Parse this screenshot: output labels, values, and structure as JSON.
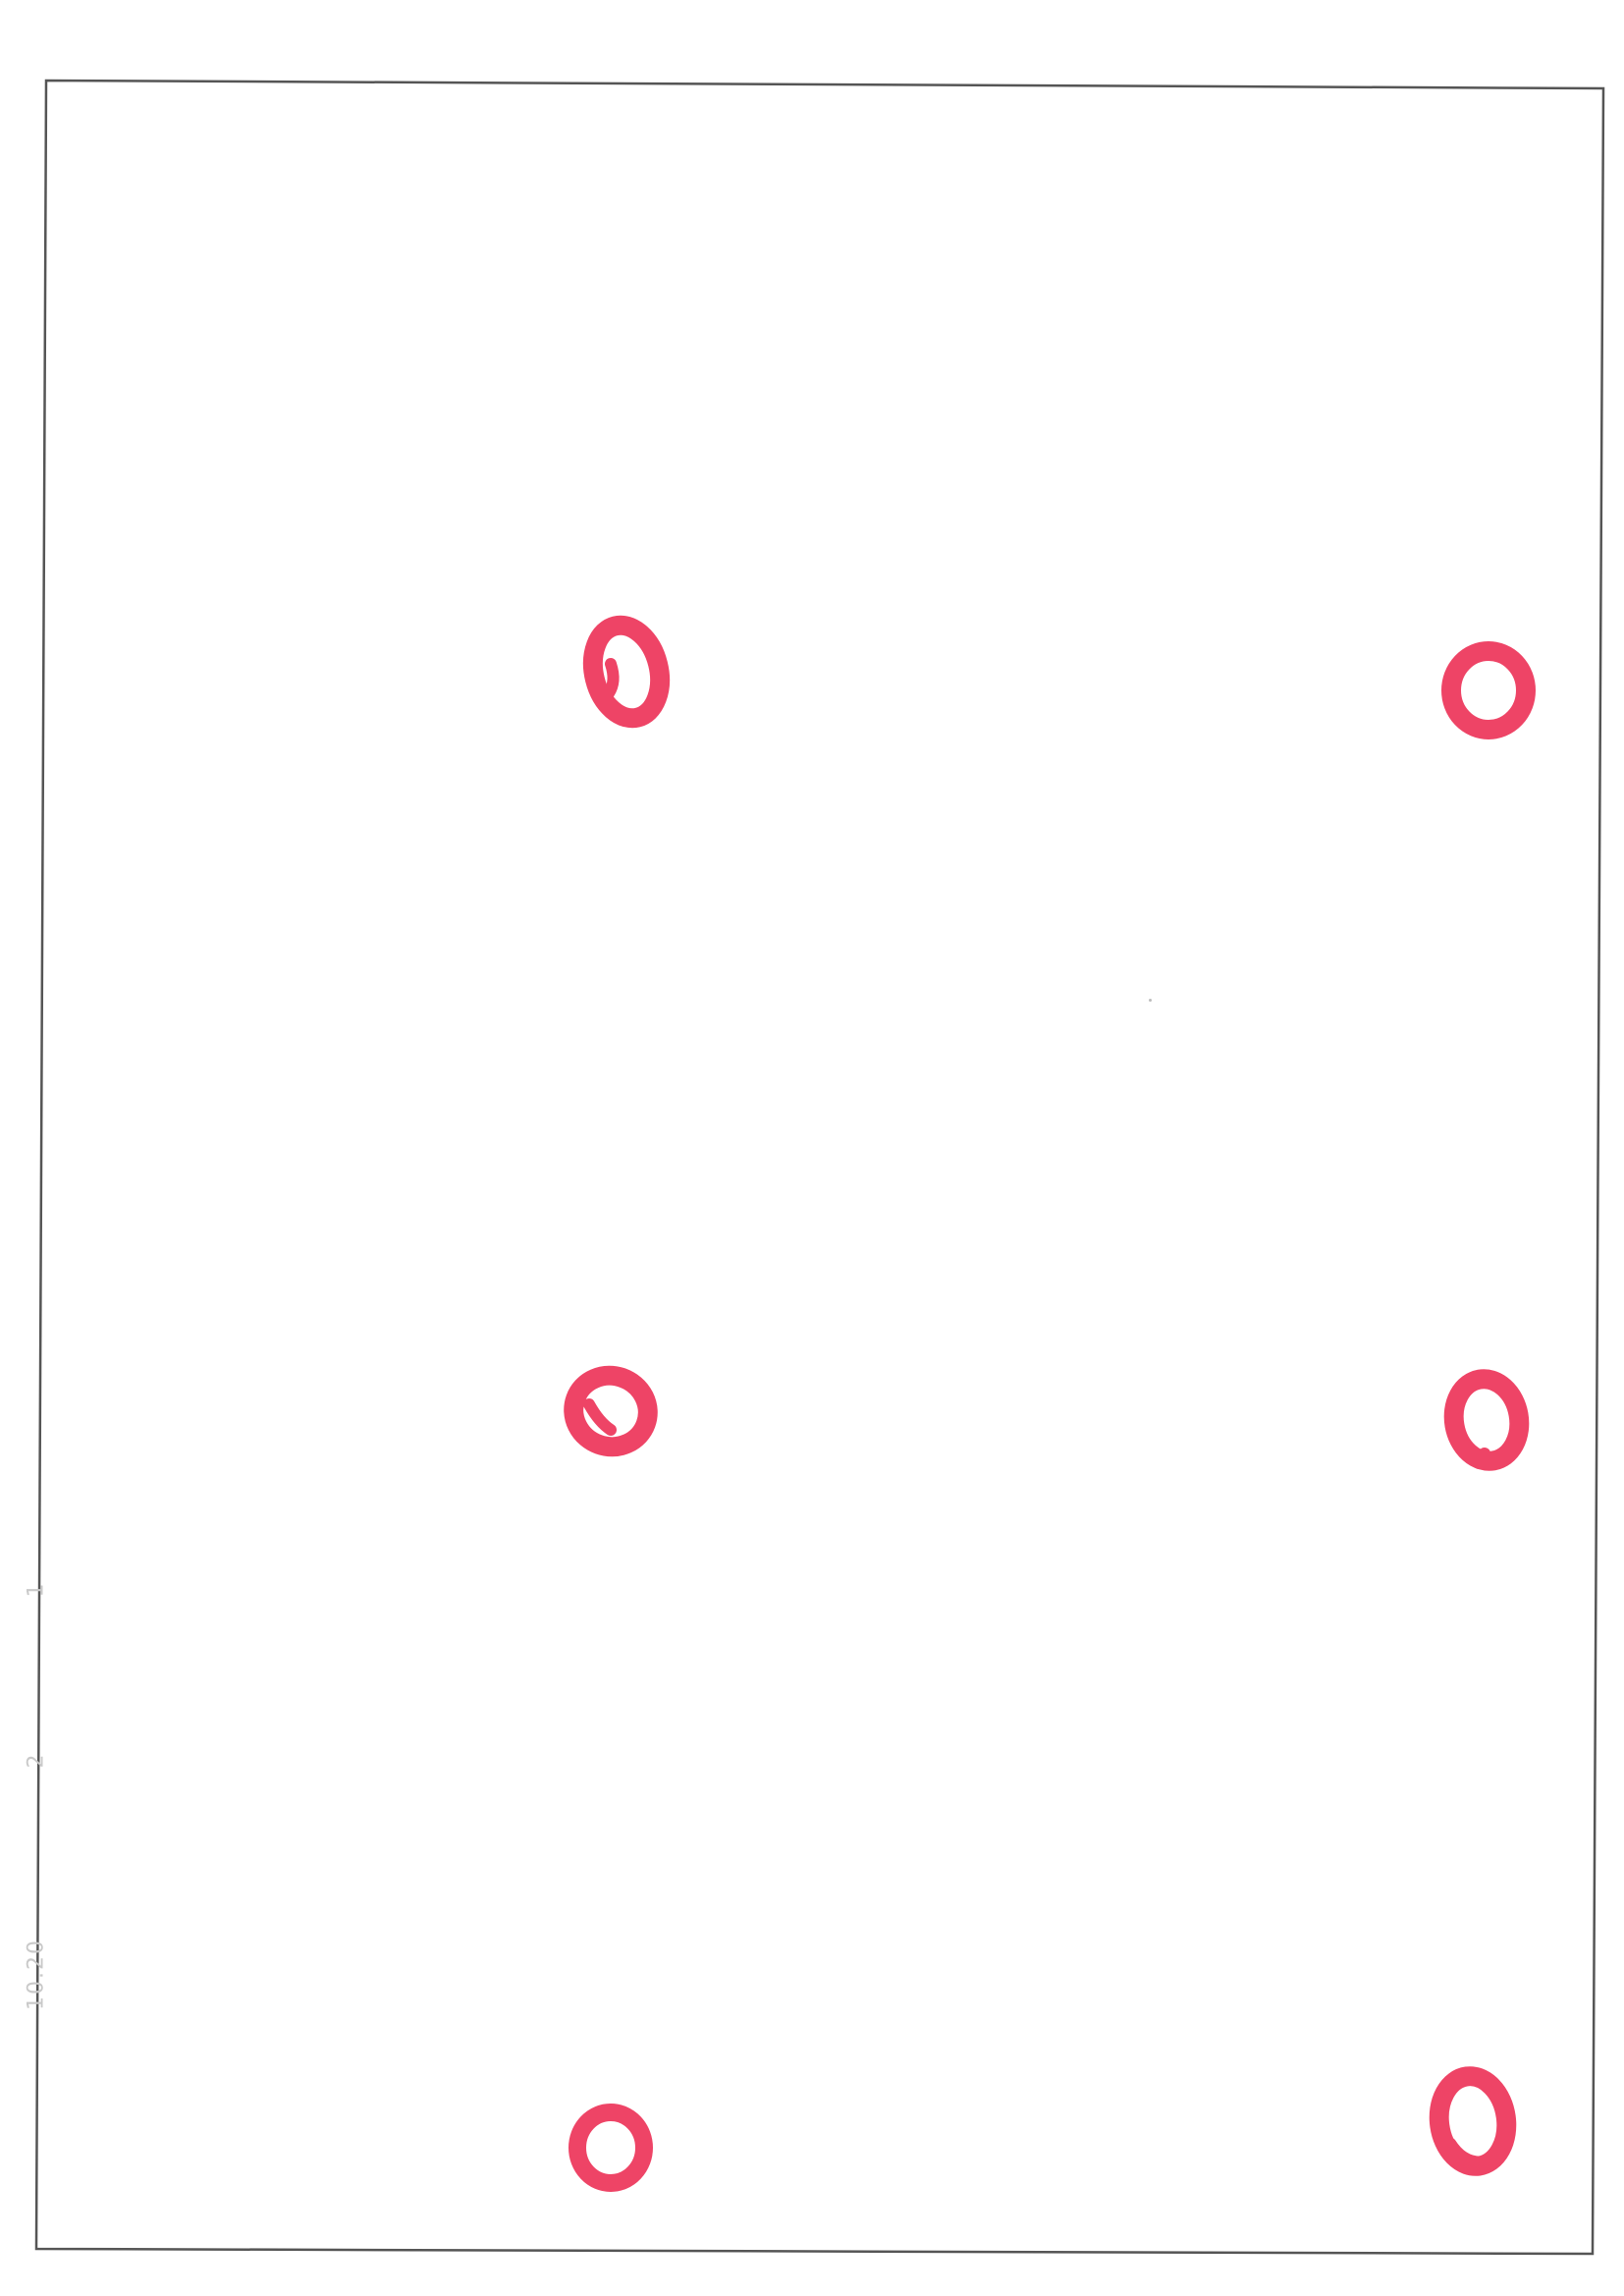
{
  "page": {
    "background_color": "#ffffff",
    "border_color": "#555555",
    "mark_color": "#ee4466"
  },
  "margin_notes": [
    "1",
    "2",
    "10.20"
  ],
  "circle_marks": {
    "shape": "hand-drawn circle",
    "count": 6
  }
}
